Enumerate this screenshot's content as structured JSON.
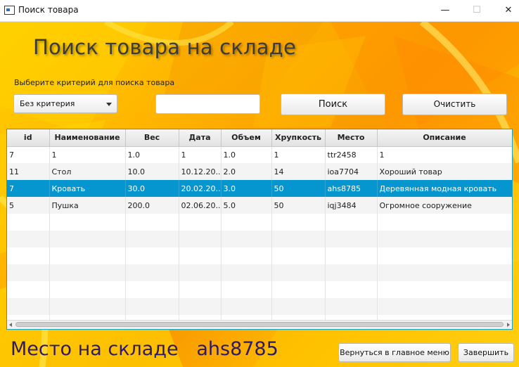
{
  "window": {
    "title": "Поиск товара",
    "min_icon": "minimize-icon",
    "max_icon": "maximize-icon",
    "close_icon": "close-icon",
    "min_glyph": "—",
    "max_glyph": "☐",
    "close_glyph": "✕"
  },
  "header": {
    "title": "Поиск товара на складе"
  },
  "search": {
    "criteria_label": "Выберите критерий для поиска товара",
    "criteria_value": "Без критерия",
    "query_value": "",
    "search_label": "Поиск",
    "clear_label": "Очистить"
  },
  "table": {
    "columns": [
      "id",
      "Наименование",
      "Вес",
      "Дата",
      "Объем",
      "Хрупкость",
      "Место",
      "Описание"
    ],
    "rows": [
      [
        "7",
        "1",
        "1.0",
        "1",
        "1.0",
        "1",
        "ttr2458",
        "1"
      ],
      [
        "11",
        "Стол",
        "10.0",
        "10.12.20...",
        "2.0",
        "14",
        "ioa7704",
        "Хороший товар"
      ],
      [
        "7",
        "Кровать",
        "30.0",
        "20.02.20...",
        "3.0",
        "50",
        "ahs8785",
        "Деревянная модная кровать"
      ],
      [
        "5",
        "Пушка",
        "200.0",
        "02.06.20...",
        "5.0",
        "50",
        "iqj3484",
        "Огромное сооружение"
      ]
    ],
    "selected_row": 2
  },
  "footer": {
    "place_text": "Место на складе   ahs8785",
    "back_label": "Вернуться в главное меню",
    "finish_label": "Завершить"
  },
  "colors": {
    "selection": "#0596cf",
    "heading": "#3b3b3b",
    "place_text": "#2d1a6a",
    "table_border": "#1f9fb8"
  }
}
